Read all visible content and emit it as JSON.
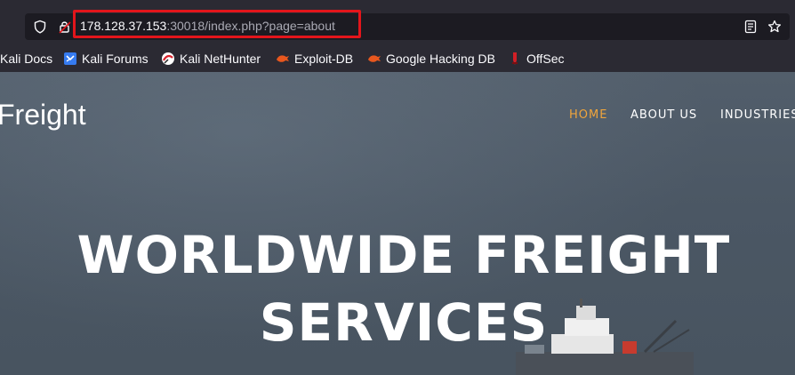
{
  "browser": {
    "url_host": "178.128.37.153",
    "url_rest": ":30018/index.php?page=about"
  },
  "bookmarks": [
    {
      "label": "Kali Docs",
      "icon": "kali-dragon-icon"
    },
    {
      "label": "Kali Forums",
      "icon": "kali-forums-icon"
    },
    {
      "label": "Kali NetHunter",
      "icon": "nethunter-icon"
    },
    {
      "label": "Exploit-DB",
      "icon": "exploit-db-icon"
    },
    {
      "label": "Google Hacking DB",
      "icon": "ghdb-icon"
    },
    {
      "label": "OffSec",
      "icon": "offsec-icon"
    }
  ],
  "site": {
    "brand": "Freight",
    "nav": {
      "home": "HOME",
      "about": "ABOUT US",
      "industries": "INDUSTRIES"
    },
    "hero_line1": "WORLDWIDE FREIGHT",
    "hero_line2": "SERVICES"
  },
  "colors": {
    "highlight": "#e3151b",
    "nav_active": "#f0a53c"
  }
}
